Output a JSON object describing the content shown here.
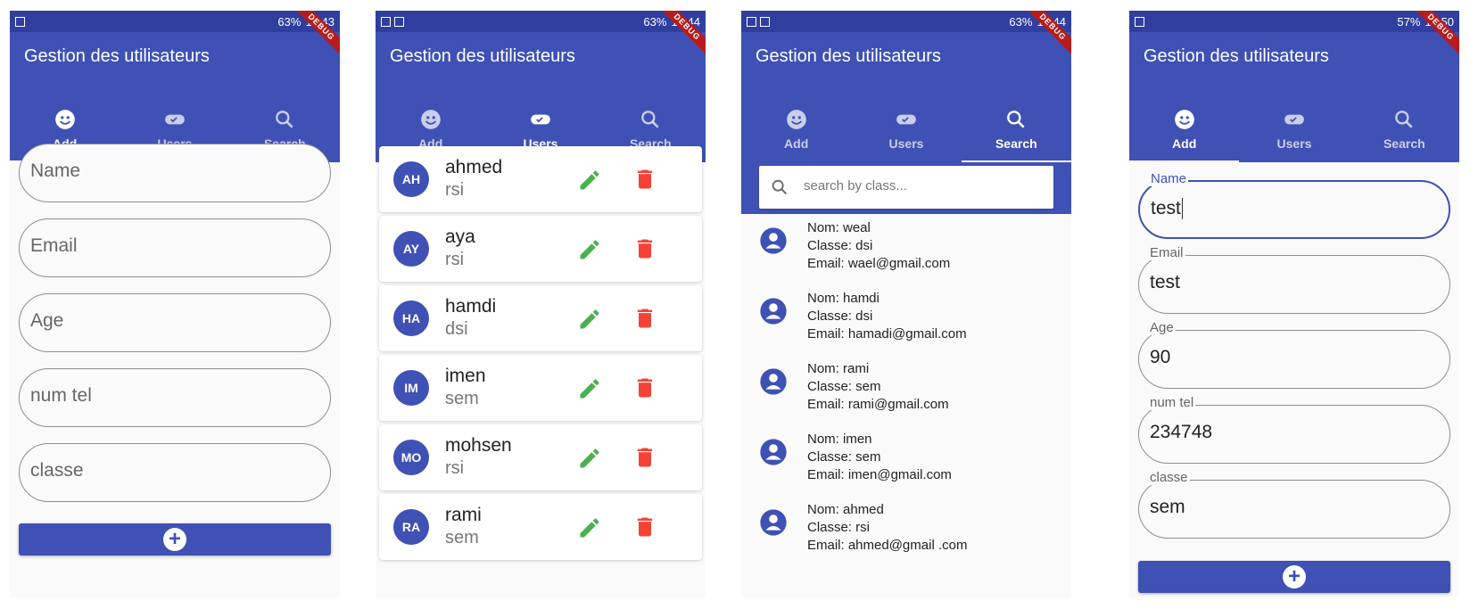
{
  "status_bars": [
    {
      "battery": "63%",
      "time": "14:43"
    },
    {
      "battery": "63%",
      "time": "14:44"
    },
    {
      "battery": "63%",
      "time": "14:44"
    },
    {
      "battery": "57%",
      "time": "14:50"
    }
  ],
  "debug_label": "DEBUG",
  "app_title": "Gestion des utilisateurs",
  "tabs": [
    {
      "label": "Add",
      "icon": "face-icon"
    },
    {
      "label": "Users",
      "icon": "toggle-icon"
    },
    {
      "label": "Search",
      "icon": "search-icon"
    }
  ],
  "add_form_empty": {
    "fields": [
      {
        "placeholder": "Name"
      },
      {
        "placeholder": "Email"
      },
      {
        "placeholder": "Age"
      },
      {
        "placeholder": "num tel"
      },
      {
        "placeholder": "classe"
      }
    ],
    "add_button_icon": "plus-circle-icon"
  },
  "users": [
    {
      "initials": "AH",
      "name": "ahmed",
      "classe": "rsi"
    },
    {
      "initials": "AY",
      "name": "aya",
      "classe": "rsi"
    },
    {
      "initials": "HA",
      "name": "hamdi",
      "classe": "dsi"
    },
    {
      "initials": "IM",
      "name": "imen",
      "classe": "sem"
    },
    {
      "initials": "MO",
      "name": "mohsen",
      "classe": "rsi"
    },
    {
      "initials": "RA",
      "name": "rami",
      "classe": "sem"
    }
  ],
  "search": {
    "placeholder": "search by class...",
    "results": [
      {
        "nom": "Nom: weal",
        "classe": "Classe: dsi",
        "email": "Email: wael@gmail.com"
      },
      {
        "nom": "Nom: hamdi",
        "classe": "Classe: dsi",
        "email": "Email: hamadi@gmail.com"
      },
      {
        "nom": "Nom: rami",
        "classe": "Classe: sem",
        "email": "Email: rami@gmail.com"
      },
      {
        "nom": "Nom: imen",
        "classe": "Classe: sem",
        "email": "Email: imen@gmail.com"
      },
      {
        "nom": "Nom: ahmed",
        "classe": "Classe: rsi",
        "email": "Email: ahmed@gmail .com"
      }
    ]
  },
  "add_form_filled": {
    "fields": [
      {
        "label": "Name",
        "value": "test"
      },
      {
        "label": "Email",
        "value": "test"
      },
      {
        "label": "Age",
        "value": "90"
      },
      {
        "label": "num tel",
        "value": "234748"
      },
      {
        "label": "classe",
        "value": "sem"
      }
    ]
  },
  "colors": {
    "primary": "#3f51b5",
    "status_bar": "#303f9f",
    "edit": "#4caf50",
    "delete": "#f44336",
    "debug_banner": "#b71c1c"
  }
}
